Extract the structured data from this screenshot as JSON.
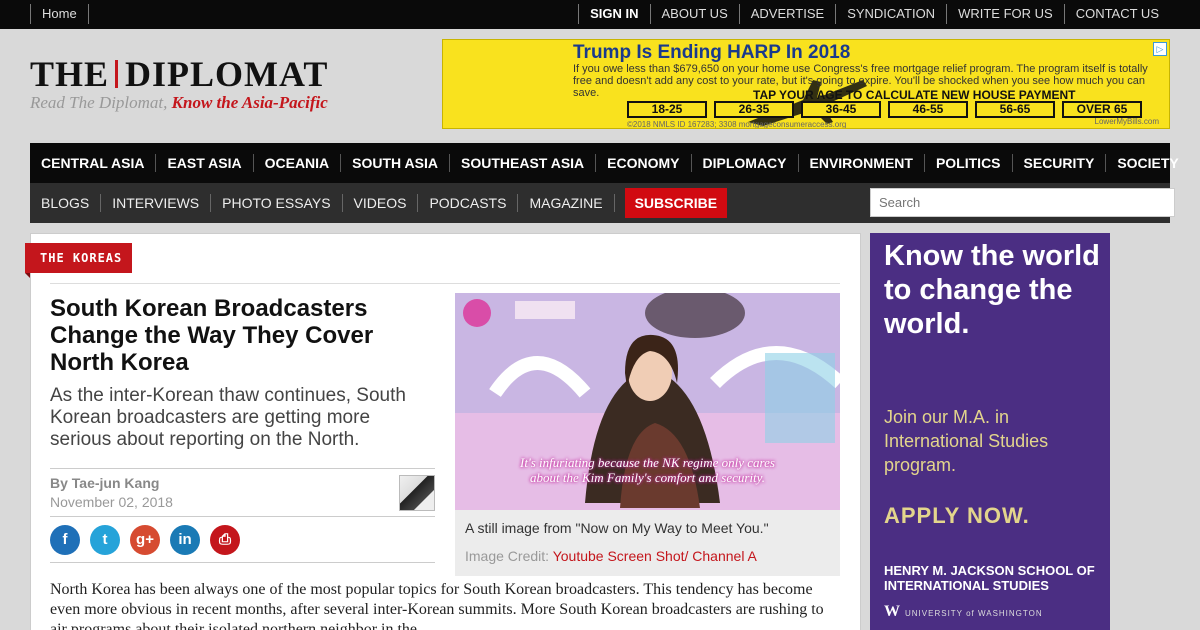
{
  "topbar": {
    "home": "Home",
    "links": [
      "SIGN IN",
      "ABOUT US",
      "ADVERTISE",
      "SYNDICATION",
      "WRITE FOR US",
      "CONTACT US"
    ]
  },
  "logo": {
    "left": "THE",
    "right": "DIPLOMAT",
    "tagline_prefix": "Read The Diplomat,",
    "tagline_emph": "Know the Asia-Pacific"
  },
  "ad": {
    "headline": "Trump Is Ending HARP In 2018",
    "body": "If you owe less than $679,650 on your home use Congress's free mortgage relief program. The program itself is totally free and doesn't add any cost to your rate, but it's going to expire. You'll be shocked when you see how much you can save.",
    "cta": "TAP YOUR AGE TO CALCULATE NEW HOUSE PAYMENT",
    "ranges": [
      "18-25",
      "26-35",
      "36-45",
      "46-55",
      "56-65",
      "OVER 65"
    ],
    "fine": "©2018 NMLS ID 167283; 3308 mortgageconsumeraccess.org",
    "brand": "LowerMyBills.com",
    "adchoice": "▷"
  },
  "nav_primary": [
    "CENTRAL ASIA",
    "EAST ASIA",
    "OCEANIA",
    "SOUTH ASIA",
    "SOUTHEAST ASIA",
    "ECONOMY",
    "DIPLOMACY",
    "ENVIRONMENT",
    "POLITICS",
    "SECURITY",
    "SOCIETY"
  ],
  "nav_secondary": [
    "BLOGS",
    "INTERVIEWS",
    "PHOTO ESSAYS",
    "VIDEOS",
    "PODCASTS",
    "MAGAZINE"
  ],
  "subscribe": "SUBSCRIBE",
  "search": {
    "placeholder": "Search"
  },
  "article": {
    "tag": "THE KOREAS",
    "title": "South Korean Broadcasters Change the Way They Cover North Korea",
    "subtitle": "As the inter-Korean thaw continues, South Korean broadcasters are getting more serious about reporting on the North.",
    "byline": "By Tae-jun Kang",
    "date": "November 02, 2018",
    "share_icons": [
      "facebook-icon",
      "twitter-icon",
      "google-plus-icon",
      "linkedin-icon",
      "print-icon"
    ],
    "share_glyphs": [
      "f",
      "t",
      "g+",
      "in",
      "⎙"
    ],
    "image_subtitle_line1": "It's infuriating because the NK regime only cares",
    "image_subtitle_line2": "about the Kim Family's comfort and security.",
    "caption": "A still image from \"Now on My Way to Meet You.\"",
    "credit_label": "Image Credit:",
    "credit_value": "Youtube Screen Shot/ Channel A",
    "body_text": "North Korea has been always one of the most popular topics for South Korean broadcasters. This tendency has become even more obvious in recent months, after several inter-Korean summits. More South Korean broadcasters are rushing to air programs about their isolated northern neighbor in the"
  },
  "sidebar_ad": {
    "headline": "Know the world to change the world.",
    "pitch": "Join our M.A. in International Studies program.",
    "apply": "APPLY NOW.",
    "school": "HENRY M. JACKSON SCHOOL OF INTERNATIONAL STUDIES",
    "uw_mark": "W",
    "uw": "UNIVERSITY of WASHINGTON"
  },
  "colors": {
    "accent": "#c4161c",
    "sidebar_purple": "#4b2e83",
    "ad_yellow": "#f9e21e"
  }
}
